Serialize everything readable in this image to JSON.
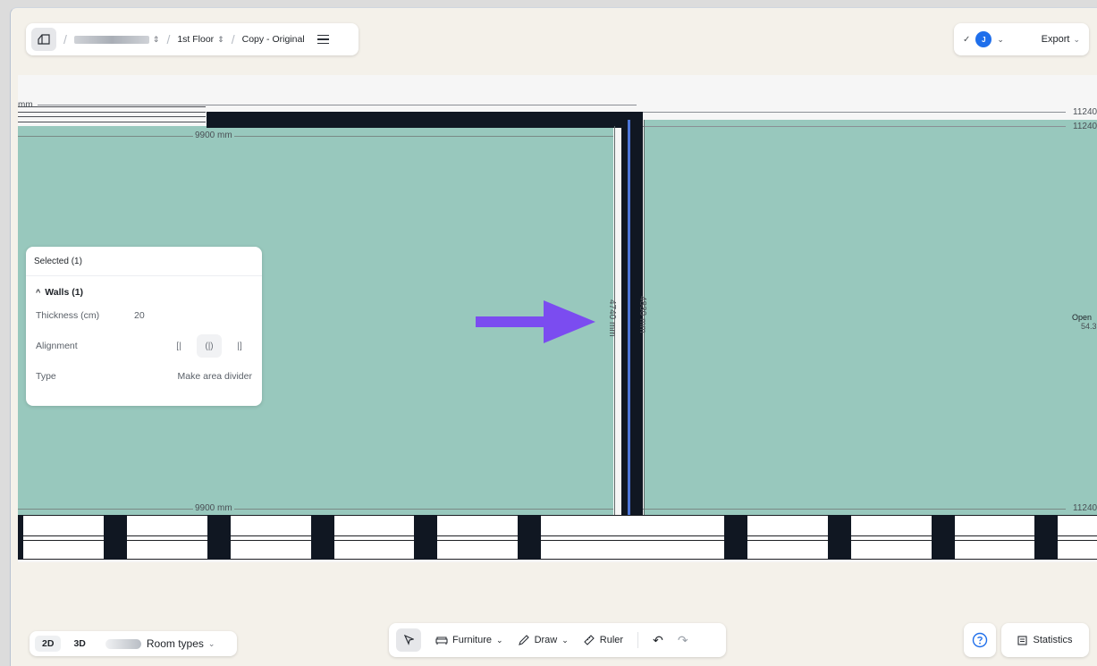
{
  "topbar": {
    "project_name": "",
    "floor": "1st Floor",
    "version": "Copy - Original",
    "avatar_initial": "J",
    "export_label": "Export"
  },
  "dimensions": {
    "top_left_width": "9900 mm",
    "bottom_left_width": "9900 mm",
    "wall_left_height": "4740 mm",
    "wall_right_height": "4830 mm",
    "right_width_top": "11240",
    "right_width_top2": "11240",
    "right_width_bottom": "11240",
    "top_left_partial": "mm"
  },
  "room_label_right": {
    "name": "Open",
    "area": "54.3"
  },
  "selection_panel": {
    "header": "Selected (1)",
    "section_title": "Walls (1)",
    "thickness_label": "Thickness (cm)",
    "thickness_value": "20",
    "alignment_label": "Alignment",
    "type_label": "Type",
    "type_action": "Make area divider"
  },
  "view_bar": {
    "tab_2d": "2D",
    "tab_3d": "3D",
    "room_types_label": "Room types"
  },
  "tools_bar": {
    "furniture_label": "Furniture",
    "draw_label": "Draw",
    "ruler_label": "Ruler"
  },
  "statistics_label": "Statistics",
  "colors": {
    "room_fill": "#98c8bd",
    "wall": "#101722",
    "selection_blue": "#4d76d9",
    "arrow": "#7b4cf0",
    "background": "#f4f1ea"
  }
}
